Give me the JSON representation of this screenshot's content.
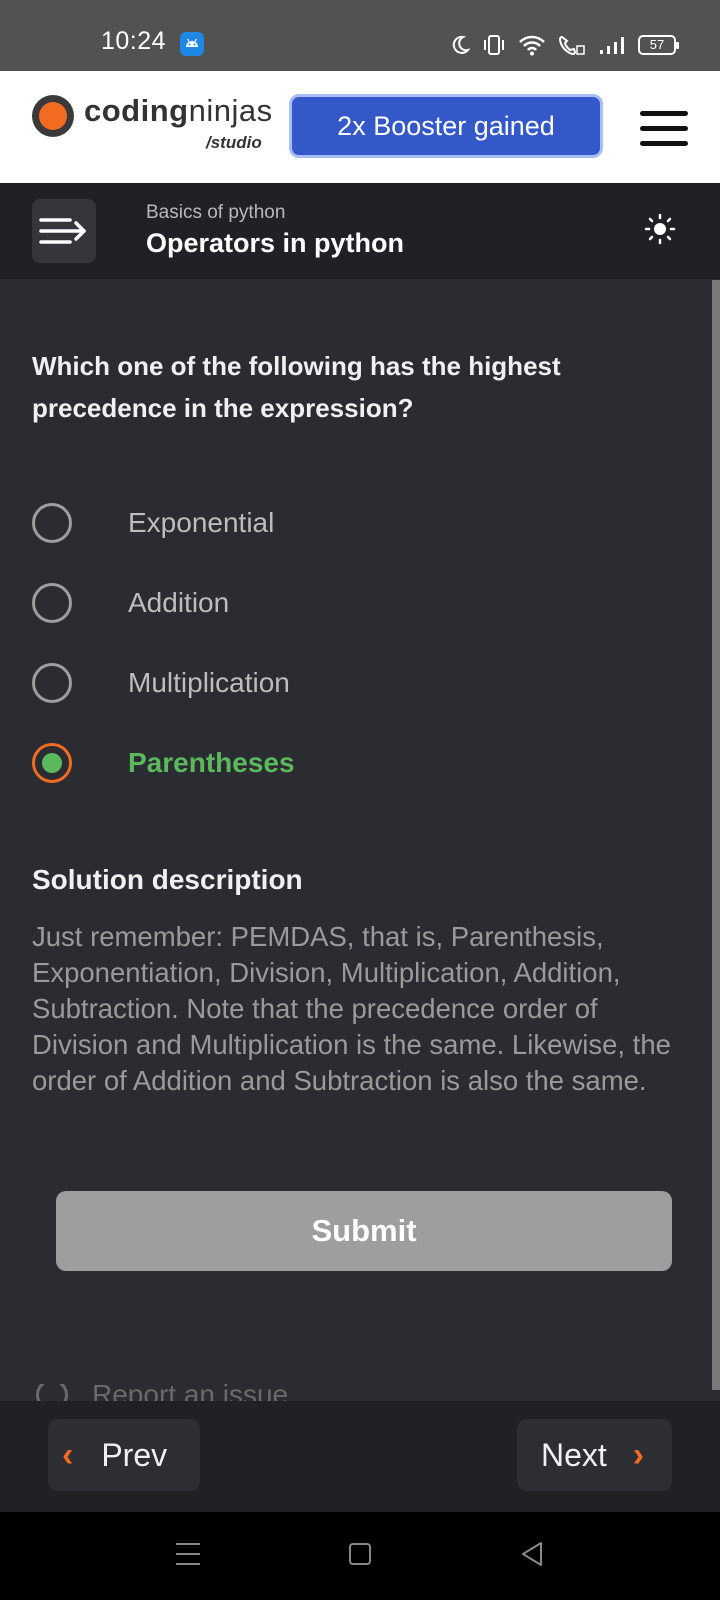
{
  "status_bar": {
    "time": "10:24",
    "battery": "57"
  },
  "header": {
    "logo_word_bold": "coding",
    "logo_word_light": "ninjas",
    "logo_sub": "/studio",
    "booster_label": "2x Booster gained"
  },
  "subheader": {
    "course": "Basics of python",
    "title": "Operators in python"
  },
  "question": {
    "text": "Which one of the following has the highest precedence in the expression?",
    "options": [
      {
        "label": "Exponential",
        "selected": false
      },
      {
        "label": "Addition",
        "selected": false
      },
      {
        "label": "Multiplication",
        "selected": false
      },
      {
        "label": "Parentheses",
        "selected": true
      }
    ]
  },
  "solution": {
    "title": "Solution description",
    "body": "Just remember: PEMDAS, that is, Parenthesis, Exponentiation, Division, Multiplication, Addition, Subtraction. Note that the precedence order of Division and Multiplication is the same. Likewise, the order of Addition and Subtraction is also the same."
  },
  "submit_label": "Submit",
  "report_label": "Report an issue",
  "nav": {
    "prev_label": "Prev",
    "next_label": "Next"
  },
  "colors": {
    "accent": "#f36b21",
    "correct": "#5cb85c",
    "booster": "#3558c9"
  }
}
